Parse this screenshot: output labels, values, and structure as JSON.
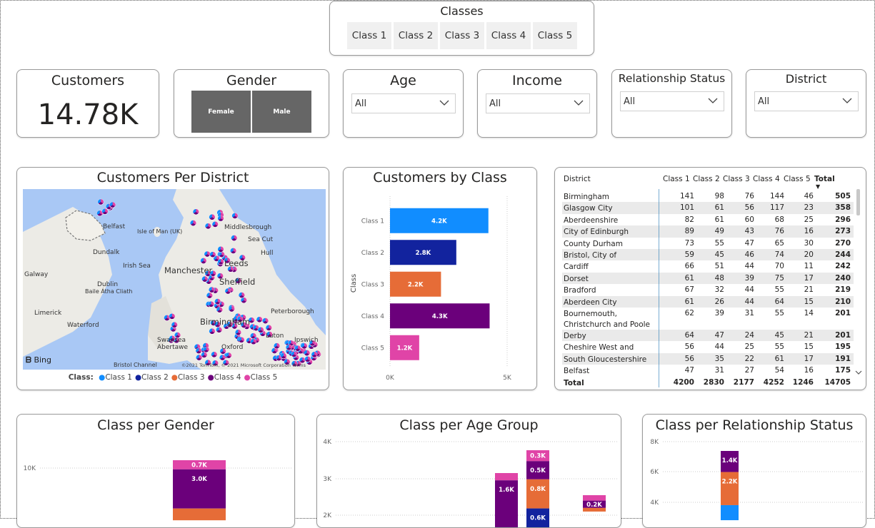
{
  "classes_slicer": {
    "title": "Classes",
    "options": [
      "Class 1",
      "Class 2",
      "Class 3",
      "Class 4",
      "Class 5"
    ]
  },
  "customers_card": {
    "title": "Customers",
    "value": "14.78K"
  },
  "gender_slicer": {
    "title": "Gender",
    "options": [
      "Female",
      "Male"
    ]
  },
  "age_slicer": {
    "title": "Age",
    "value": "All"
  },
  "income_slicer": {
    "title": "Income",
    "value": "All"
  },
  "relationship_slicer": {
    "title": "Relationship Status",
    "value": "All"
  },
  "district_slicer": {
    "title": "District",
    "value": "All"
  },
  "map": {
    "title": "Customers Per District",
    "labels": [
      "Belfast",
      "Isle of Man (UK)",
      "Middlesbrough",
      "Sea Cut",
      "Dundalk",
      "Hull",
      "Irish Sea",
      "Manchester",
      "Leeds",
      "Galway",
      "Dublin",
      "Baile Átha Cliath",
      "Sheffield",
      "Limerick",
      "Peterborough",
      "Waterford",
      "Birmingham",
      "Swansea",
      "Abertawe",
      "Luton",
      "Ipswich",
      "Oxford",
      "Bristol Channel"
    ],
    "bing": "Bing",
    "copyright": "©2021 TomTom, © 2021 Microsoft Corporation  Terms",
    "legend_label": "Class:",
    "legend": [
      {
        "name": "Class 1",
        "color": "#118DFF"
      },
      {
        "name": "Class 2",
        "color": "#12239E"
      },
      {
        "name": "Class 3",
        "color": "#E66C37"
      },
      {
        "name": "Class 4",
        "color": "#6B007B"
      },
      {
        "name": "Class 5",
        "color": "#E044A7"
      }
    ]
  },
  "class_bar": {
    "title": "Customers by Class",
    "chart_data": {
      "type": "bar",
      "categories": [
        "Class 1",
        "Class 2",
        "Class 3",
        "Class 4",
        "Class 5"
      ],
      "values": [
        4200,
        2830,
        2177,
        4252,
        1246
      ],
      "labels": [
        "4.2K",
        "2.8K",
        "2.2K",
        "4.3K",
        "1.2K"
      ],
      "colors": [
        "#118DFF",
        "#12239E",
        "#E66C37",
        "#6B007B",
        "#E044A7"
      ],
      "ylabel": "Class",
      "xlim": [
        0,
        5000
      ],
      "xticks": [
        "0K",
        "5K"
      ]
    }
  },
  "matrix": {
    "headers": [
      "District",
      "Class 1",
      "Class 2",
      "Class 3",
      "Class 4",
      "Class 5",
      "Total"
    ],
    "rows": [
      {
        "name": "Birmingham",
        "vals": [
          "141",
          "98",
          "76",
          "144",
          "46",
          "505"
        ]
      },
      {
        "name": "Glasgow City",
        "vals": [
          "101",
          "61",
          "56",
          "117",
          "23",
          "358"
        ]
      },
      {
        "name": "Aberdeenshire",
        "vals": [
          "82",
          "61",
          "60",
          "68",
          "25",
          "296"
        ]
      },
      {
        "name": "City of Edinburgh",
        "vals": [
          "89",
          "49",
          "43",
          "76",
          "16",
          "273"
        ]
      },
      {
        "name": "County Durham",
        "vals": [
          "73",
          "55",
          "47",
          "65",
          "30",
          "270"
        ]
      },
      {
        "name": "Bristol, City of",
        "vals": [
          "59",
          "45",
          "46",
          "74",
          "20",
          "244"
        ]
      },
      {
        "name": "Cardiff",
        "vals": [
          "66",
          "51",
          "44",
          "70",
          "11",
          "242"
        ]
      },
      {
        "name": "Dorset",
        "vals": [
          "61",
          "48",
          "39",
          "75",
          "17",
          "240"
        ]
      },
      {
        "name": "Bradford",
        "vals": [
          "67",
          "32",
          "44",
          "55",
          "21",
          "219"
        ]
      },
      {
        "name": "Aberdeen City",
        "vals": [
          "61",
          "26",
          "44",
          "64",
          "15",
          "210"
        ]
      },
      {
        "name": "Bournemouth, Christchurch and Poole",
        "vals": [
          "62",
          "39",
          "31",
          "55",
          "14",
          "201"
        ]
      },
      {
        "name": "Derby",
        "vals": [
          "64",
          "47",
          "24",
          "45",
          "21",
          "201"
        ]
      },
      {
        "name": "Cheshire West and Chester",
        "vals": [
          "56",
          "44",
          "25",
          "55",
          "15",
          "195"
        ]
      },
      {
        "name": "South Gloucestershire",
        "vals": [
          "56",
          "35",
          "22",
          "61",
          "17",
          "191"
        ]
      },
      {
        "name": "Belfast",
        "vals": [
          "47",
          "31",
          "27",
          "54",
          "16",
          "175"
        ]
      }
    ],
    "total": {
      "name": "Total",
      "vals": [
        "4200",
        "2830",
        "2177",
        "4252",
        "1246",
        "14705"
      ]
    }
  },
  "gender_chart": {
    "title": "Class per Gender",
    "chart_data": {
      "type": "bar",
      "yticks": [
        "10K"
      ],
      "segments": [
        {
          "label": "0.7K",
          "value": 700,
          "color": "#E044A7"
        },
        {
          "label": "3.0K",
          "value": 3000,
          "color": "#6B007B"
        },
        {
          "label": "",
          "value": 900,
          "color": "#E66C37"
        }
      ]
    }
  },
  "age_chart": {
    "title": "Class per Age Group",
    "chart_data": {
      "type": "bar",
      "yticks": [
        "4K",
        "3K",
        "2K"
      ],
      "columns": [
        {
          "segments": [
            {
              "label": "",
              "value": 200,
              "color": "#E044A7"
            },
            {
              "label": "1.6K",
              "value": 1600,
              "color": "#6B007B"
            }
          ]
        },
        {
          "segments": [
            {
              "label": "0.3K",
              "value": 300,
              "color": "#E044A7"
            },
            {
              "label": "0.5K",
              "value": 500,
              "color": "#6B007B"
            },
            {
              "label": "0.8K",
              "value": 800,
              "color": "#E66C37"
            },
            {
              "label": "0.6K",
              "value": 600,
              "color": "#12239E"
            }
          ]
        },
        {
          "segments": [
            {
              "label": "",
              "value": 150,
              "color": "#E044A7"
            },
            {
              "label": "0.2K",
              "value": 200,
              "color": "#6B007B"
            },
            {
              "label": "",
              "value": 100,
              "color": "#E66C37"
            }
          ]
        }
      ]
    }
  },
  "rel_chart": {
    "title": "Class per Relationship Status",
    "chart_data": {
      "type": "bar",
      "yticks": [
        "8K",
        "6K",
        "4K"
      ],
      "segments": [
        {
          "label": "1.4K",
          "value": 1400,
          "color": "#6B007B"
        },
        {
          "label": "2.2K",
          "value": 2200,
          "color": "#E66C37"
        },
        {
          "label": "",
          "value": 1000,
          "color": "#118DFF"
        }
      ]
    }
  }
}
